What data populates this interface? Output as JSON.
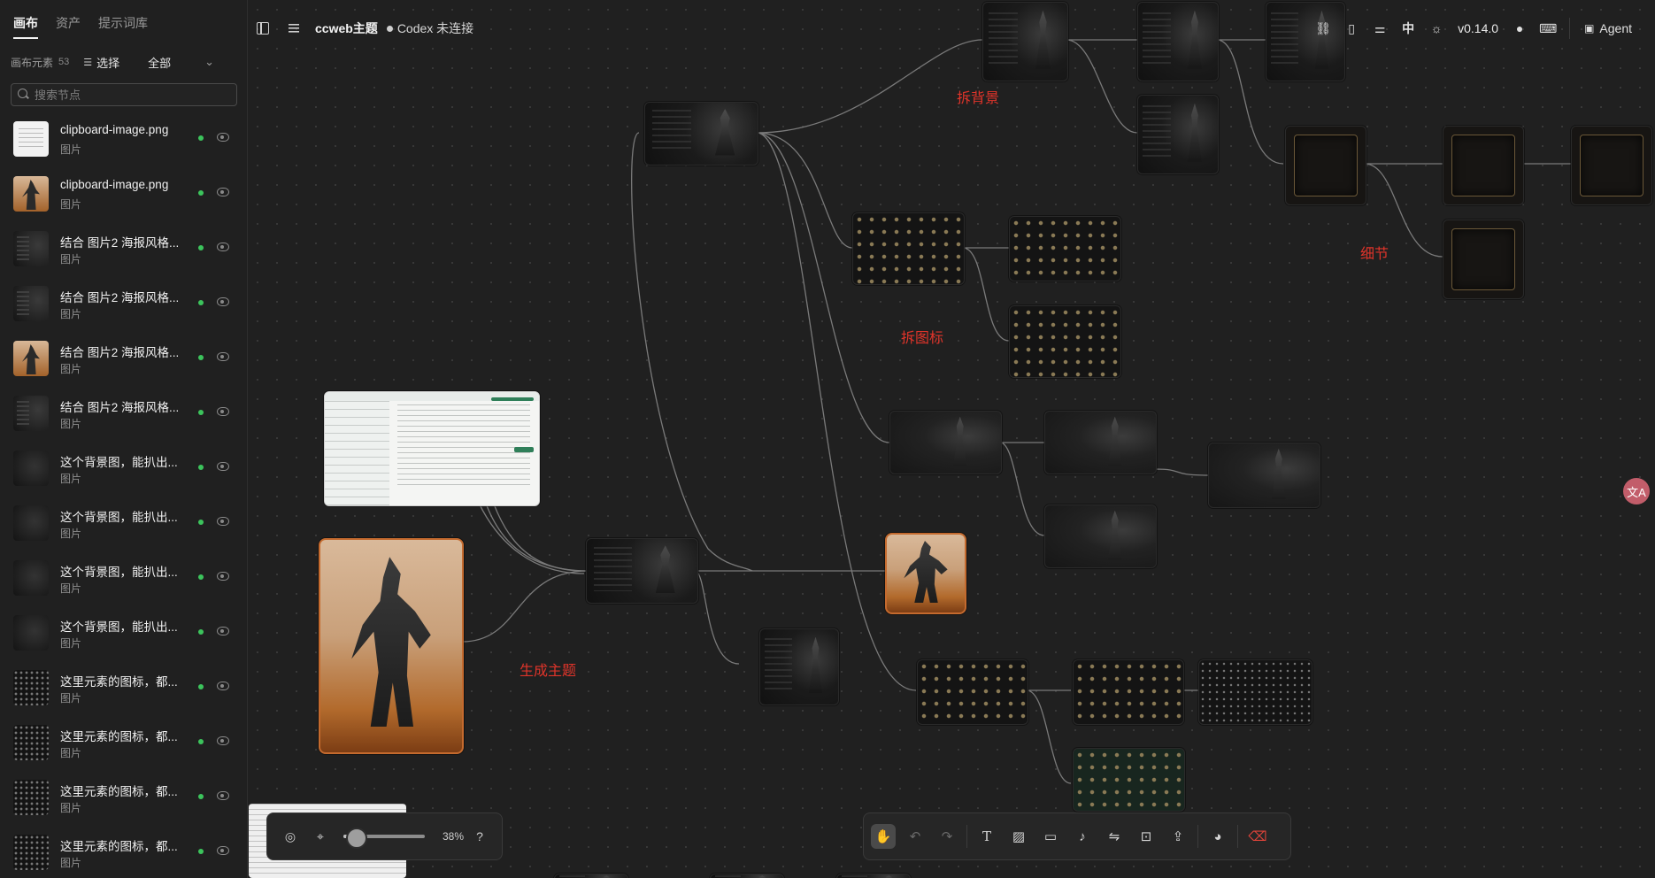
{
  "sidebar": {
    "tabs": [
      {
        "label": "画布",
        "active": true
      },
      {
        "label": "资产",
        "active": false
      },
      {
        "label": "提示词库",
        "active": false
      }
    ],
    "count_label": "画布元素",
    "count": "53",
    "select_label": "选择",
    "filter_value": "全部",
    "search_placeholder": "搜索节点",
    "items": [
      {
        "title": "clipboard-image.png",
        "type": "图片",
        "thumb": "white"
      },
      {
        "title": "clipboard-image.png",
        "type": "图片",
        "thumb": "art"
      },
      {
        "title": "结合 图片2 海报风格...",
        "type": "图片",
        "thumb": "ui"
      },
      {
        "title": "结合 图片2 海报风格...",
        "type": "图片",
        "thumb": "ui"
      },
      {
        "title": "结合 图片2 海报风格...",
        "type": "图片",
        "thumb": "art"
      },
      {
        "title": "结合 图片2 海报风格...",
        "type": "图片",
        "thumb": "ui"
      },
      {
        "title": "这个背景图，能扒出...",
        "type": "图片",
        "thumb": "dark"
      },
      {
        "title": "这个背景图，能扒出...",
        "type": "图片",
        "thumb": "dark"
      },
      {
        "title": "这个背景图，能扒出...",
        "type": "图片",
        "thumb": "dark"
      },
      {
        "title": "这个背景图，能扒出...",
        "type": "图片",
        "thumb": "dark"
      },
      {
        "title": "这里元素的图标，都...",
        "type": "图片",
        "thumb": "icons"
      },
      {
        "title": "这里元素的图标，都...",
        "type": "图片",
        "thumb": "icons"
      },
      {
        "title": "这里元素的图标，都...",
        "type": "图片",
        "thumb": "icons"
      },
      {
        "title": "这里元素的图标，都...",
        "type": "图片",
        "thumb": "icons"
      }
    ]
  },
  "header": {
    "project": "ccweb主题",
    "status": "Codex 未连接",
    "lang": "中",
    "version": "v0.14.0",
    "agent_label": "Agent"
  },
  "canvas": {
    "annotations": [
      "拆背景",
      "拆图标",
      "细节",
      "生成主题"
    ]
  },
  "zoom": {
    "value": 38,
    "label": "38%"
  },
  "toolbar": {
    "tools": [
      "hand",
      "undo",
      "redo",
      "text",
      "image",
      "video",
      "audio",
      "connect",
      "capture",
      "export",
      "palette",
      "eraser"
    ]
  },
  "fab": {
    "label": "文A"
  },
  "colors": {
    "accent": "#e0342a",
    "status_ok": "#3cc45c",
    "edge": "#8a8a8a"
  }
}
